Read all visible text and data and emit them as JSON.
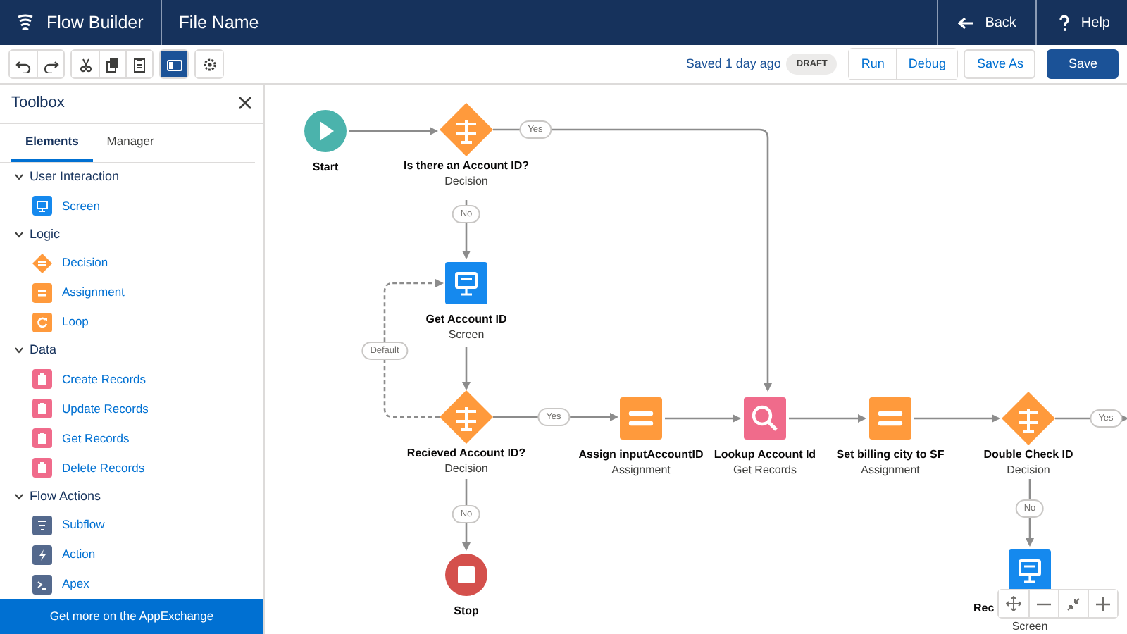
{
  "header": {
    "app_title": "Flow Builder",
    "file_name": "File Name",
    "back": "Back",
    "help": "Help"
  },
  "toolbar": {
    "tool_groups": [
      {
        "tools": [
          {
            "kind": "undo",
            "selected": false
          },
          {
            "kind": "redo",
            "selected": false
          }
        ]
      },
      {
        "tools": [
          {
            "kind": "cut",
            "selected": false
          },
          {
            "kind": "copy",
            "selected": false
          },
          {
            "kind": "paste",
            "selected": false
          }
        ]
      },
      {
        "tools": [
          {
            "kind": "panel",
            "selected": true
          }
        ]
      },
      {
        "tools": [
          {
            "kind": "settings",
            "selected": false
          }
        ]
      }
    ],
    "save_status": "Saved 1 day ago",
    "status_badge": "DRAFT",
    "run": "Run",
    "debug": "Debug",
    "save_as": "Save As",
    "save": "Save"
  },
  "sidebar": {
    "title": "Toolbox",
    "tabs": [
      {
        "label": "Elements",
        "selected": true
      },
      {
        "label": "Manager",
        "selected": false
      }
    ],
    "sections": [
      {
        "label": "User Interaction",
        "expanded": true,
        "items": [
          {
            "label": "Screen",
            "kind": "screen"
          }
        ]
      },
      {
        "label": "Logic",
        "expanded": true,
        "items": [
          {
            "label": "Decision",
            "kind": "decision"
          },
          {
            "label": "Assignment",
            "kind": "assignment"
          },
          {
            "label": "Loop",
            "kind": "loop"
          }
        ]
      },
      {
        "label": "Data",
        "expanded": true,
        "items": [
          {
            "label": "Create Records",
            "kind": "record"
          },
          {
            "label": "Update Records",
            "kind": "record"
          },
          {
            "label": "Get Records",
            "kind": "record"
          },
          {
            "label": "Delete Records",
            "kind": "record"
          }
        ]
      },
      {
        "label": "Flow Actions",
        "expanded": true,
        "items": [
          {
            "label": "Subflow",
            "kind": "subflow"
          },
          {
            "label": "Action",
            "kind": "action"
          },
          {
            "label": "Apex",
            "kind": "apex"
          }
        ]
      }
    ],
    "footer": "Get more on the AppExchange"
  },
  "canvas": {
    "nodes": [
      {
        "kind": "start",
        "title": "Start"
      },
      {
        "kind": "decision",
        "title": "Is there an Account ID?",
        "subtitle": "Decision"
      },
      {
        "kind": "screen",
        "title": "Get Account ID",
        "subtitle": "Screen"
      },
      {
        "kind": "decision",
        "title": "Recieved Account ID?",
        "subtitle": "Decision"
      },
      {
        "kind": "assignment",
        "title": "Assign inputAccountID",
        "subtitle": "Assignment"
      },
      {
        "kind": "get_records",
        "title": "Lookup Account Id",
        "subtitle": "Get Records"
      },
      {
        "kind": "assignment",
        "title": "Set billing city to SF",
        "subtitle": "Assignment"
      },
      {
        "kind": "decision",
        "title": "Double Check ID",
        "subtitle": "Decision"
      },
      {
        "kind": "stop",
        "title": "Stop"
      },
      {
        "kind": "screen",
        "title": "Rec",
        "subtitle": "Screen"
      }
    ],
    "connectors": [
      {
        "label": "Yes"
      },
      {
        "label": "No"
      },
      {
        "label": "Default"
      },
      {
        "label": "Yes"
      },
      {
        "label": "No"
      },
      {
        "label": "Yes"
      },
      {
        "label": "No"
      }
    ]
  }
}
